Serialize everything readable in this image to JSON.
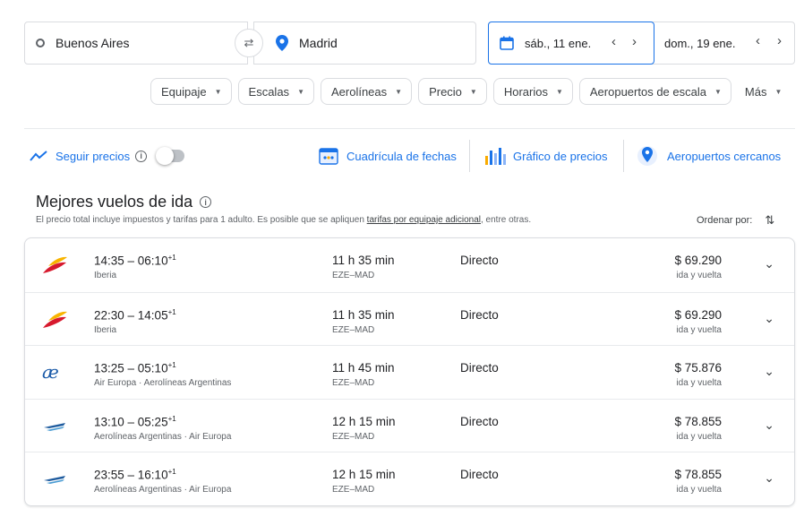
{
  "search": {
    "origin": "Buenos Aires",
    "destination": "Madrid",
    "departure": "sáb., 11 ene.",
    "return": "dom., 19 ene."
  },
  "filters": [
    "Equipaje",
    "Escalas",
    "Aerolíneas",
    "Precio",
    "Horarios",
    "Aeropuertos de escala",
    "Más"
  ],
  "tools": {
    "track_prices": "Seguir precios",
    "date_grid": "Cuadrícula de fechas",
    "price_graph": "Gráfico de precios",
    "nearby_airports": "Aeropuertos cercanos"
  },
  "section": {
    "title": "Mejores vuelos de ida",
    "subtitle_pre": "El precio total incluye impuestos y tarifas para 1 adulto. Es posible que se apliquen ",
    "subtitle_link": "tarifas por equipaje adicional",
    "subtitle_post": ", entre otras.",
    "sort_label": "Ordenar por:"
  },
  "flights": [
    {
      "times": "14:35 – 06:10",
      "plus": "+1",
      "airline": "Iberia",
      "duration": "11 h 35 min",
      "route": "EZE–MAD",
      "stops": "Directo",
      "price": "$ 69.290",
      "price_type": "ida y vuelta",
      "logo": "iberia"
    },
    {
      "times": "22:30 – 14:05",
      "plus": "+1",
      "airline": "Iberia",
      "duration": "11 h 35 min",
      "route": "EZE–MAD",
      "stops": "Directo",
      "price": "$ 69.290",
      "price_type": "ida y vuelta",
      "logo": "iberia"
    },
    {
      "times": "13:25 – 05:10",
      "plus": "+1",
      "airline": "Air Europa  ·  Aerolíneas Argentinas",
      "duration": "11 h 45 min",
      "route": "EZE–MAD",
      "stops": "Directo",
      "price": "$ 75.876",
      "price_type": "ida y vuelta",
      "logo": "aireuropa"
    },
    {
      "times": "13:10 – 05:25",
      "plus": "+1",
      "airline": "Aerolíneas Argentinas  ·  Air Europa",
      "duration": "12 h 15 min",
      "route": "EZE–MAD",
      "stops": "Directo",
      "price": "$ 78.855",
      "price_type": "ida y vuelta",
      "logo": "aerolineas"
    },
    {
      "times": "23:55 – 16:10",
      "plus": "+1",
      "airline": "Aerolíneas Argentinas  ·  Air Europa",
      "duration": "12 h 15 min",
      "route": "EZE–MAD",
      "stops": "Directo",
      "price": "$ 78.855",
      "price_type": "ida y vuelta",
      "logo": "aerolineas"
    }
  ],
  "colors": {
    "accent": "#1a73e8",
    "iberia_red": "#d7192d",
    "iberia_yellow": "#f8b400"
  }
}
